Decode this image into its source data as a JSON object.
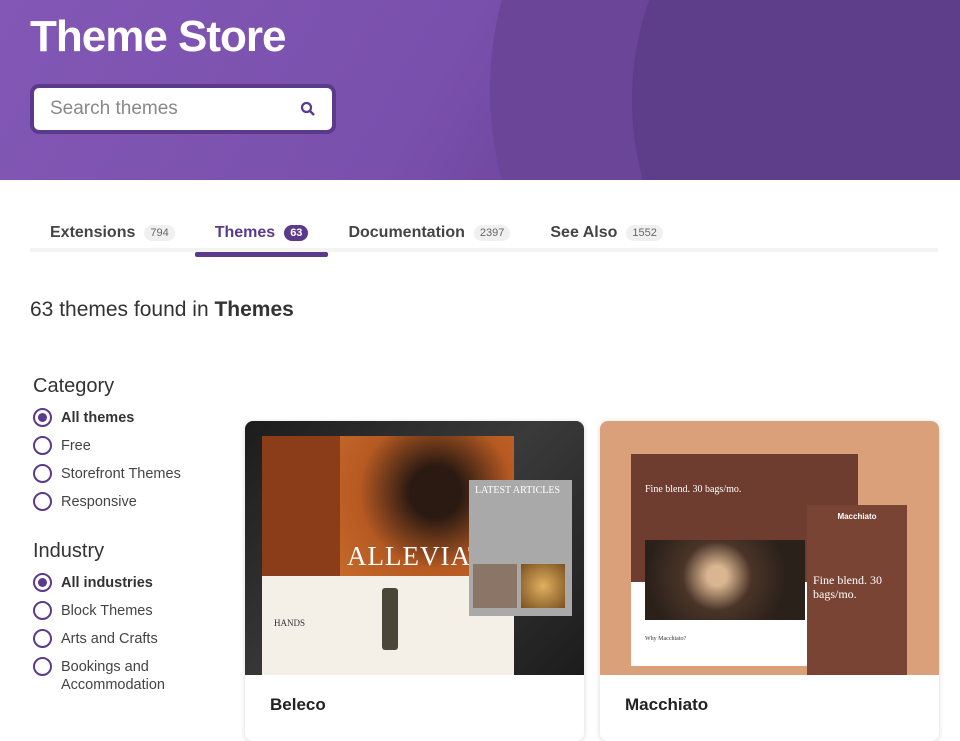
{
  "header": {
    "title": "Theme Store",
    "search_placeholder": "Search themes",
    "search_icon": "magnifier-icon",
    "colors": {
      "primary": "#5b3a8c",
      "hero": "#7f55b1"
    }
  },
  "tabs": [
    {
      "label": "Extensions",
      "count": "794"
    },
    {
      "label": "Themes",
      "count": "63",
      "active": true
    },
    {
      "label": "Documentation",
      "count": "2397"
    },
    {
      "label": "See Also",
      "count": "1552"
    }
  ],
  "results": {
    "prefix": "63 themes found in",
    "scope": "Themes"
  },
  "filters": {
    "category": {
      "title": "Category",
      "options": [
        "All themes",
        "Free",
        "Storefront Themes",
        "Responsive"
      ],
      "selected": "All themes"
    },
    "industry": {
      "title": "Industry",
      "options": [
        "All industries",
        "Block Themes",
        "Arts and Crafts",
        "Bookings and Accommodation"
      ],
      "selected": "All industries"
    }
  },
  "themes": [
    {
      "name": "Beleco",
      "preview": {
        "headline": "ALLEVIAT",
        "articles": "LATEST ARTICLES",
        "section": "HANDS"
      }
    },
    {
      "name": "Macchiato",
      "preview": {
        "headline": "Fine blend. 30 bags/mo.",
        "brand": "Macchiato",
        "section": "Why Macchiato?"
      }
    }
  ]
}
